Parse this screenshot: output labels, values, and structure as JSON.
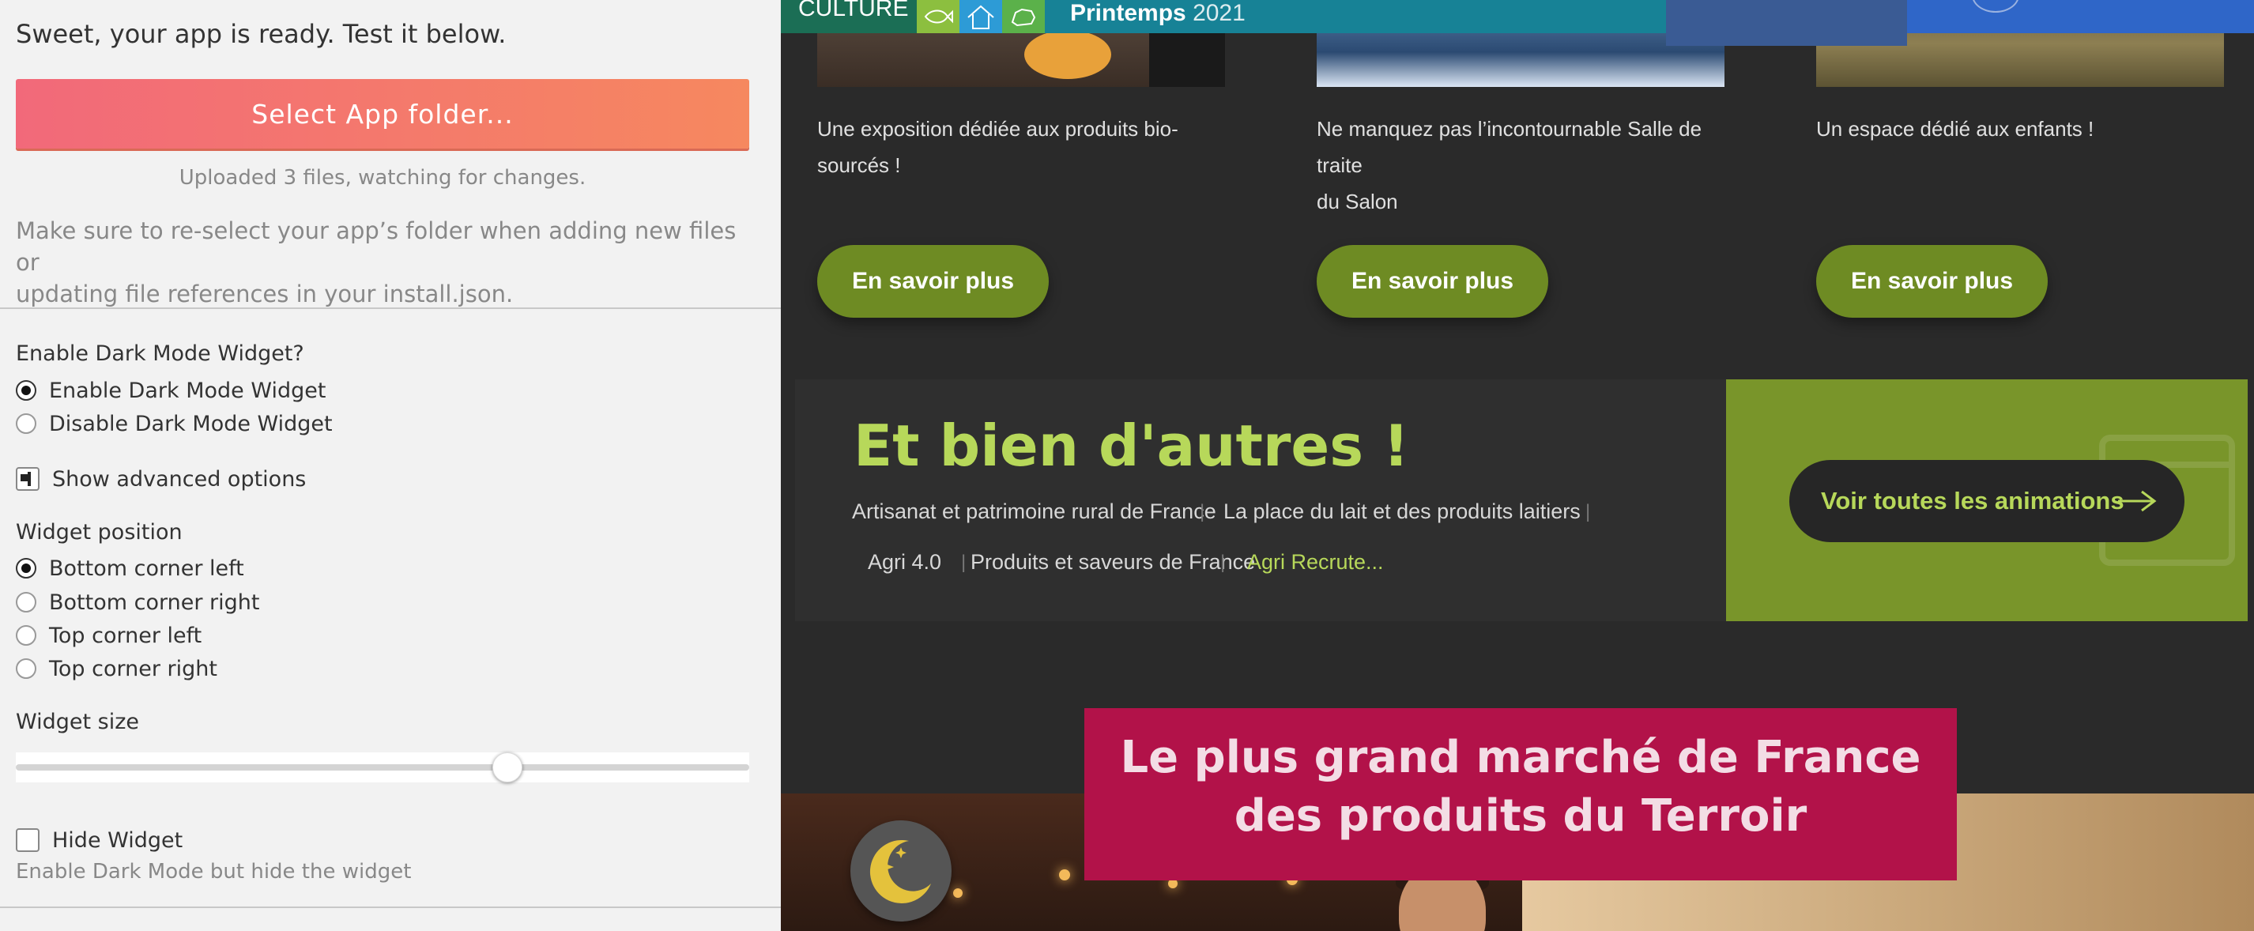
{
  "panel": {
    "ready_text": "Sweet, your app is ready. Test it below.",
    "select_button": "Select App folder...",
    "uploaded_text": "Uploaded 3 files, watching for changes.",
    "note_line1": "Make sure to re-select your app’s folder when adding new files or",
    "note_line2": "updating file references in your install.json.",
    "dark_mode_label": "Enable Dark Mode Widget?",
    "dark_mode_options": [
      "Enable Dark Mode Widget",
      "Disable Dark Mode Widget"
    ],
    "dark_mode_selected": "Enable Dark Mode Widget",
    "advanced_label": "Show advanced options",
    "position_label": "Widget position",
    "position_options": [
      "Bottom corner left",
      "Bottom corner right",
      "Top corner left",
      "Top corner right"
    ],
    "position_selected": "Bottom corner left",
    "size_label": "Widget size",
    "size_value": 0.67,
    "hide_label": "Hide Widget",
    "hide_checked": false,
    "hide_hint": "Enable Dark Mode but hide the widget"
  },
  "site": {
    "topbar": {
      "culture": "CULTURE",
      "printemps_bold": "Printemps",
      "printemps_year": "2021",
      "icons": [
        "fish-icon",
        "house-icon",
        "animal-icon"
      ]
    },
    "cards": [
      {
        "desc": "Une exposition dédiée aux produits bio-sourcés !",
        "button": "En savoir plus"
      },
      {
        "desc_line1": "Ne manquez pas l’incontournable Salle de traite",
        "desc_line2": "du Salon",
        "button": "En savoir plus"
      },
      {
        "desc": "Un espace dédié aux enfants !",
        "button": "En savoir plus"
      }
    ],
    "others": {
      "heading": "Et bien d'autres !",
      "tags": [
        "Artisanat et patrimoine rural de France",
        "La place du lait et des produits laitiers",
        "Agri 4.0",
        "Produits et saveurs de France",
        "Agri Recrute..."
      ],
      "all_button": "Voir toutes les animations"
    },
    "banner": {
      "line1": "Le plus grand marché de France",
      "line2": "des produits du Terroir"
    },
    "colors": {
      "accent_green": "#6e8b23",
      "heading_green": "#b7d85a",
      "banner_magenta": "#b21249",
      "button_gradient_start": "#f2697a",
      "button_gradient_end": "#f6885f"
    }
  }
}
